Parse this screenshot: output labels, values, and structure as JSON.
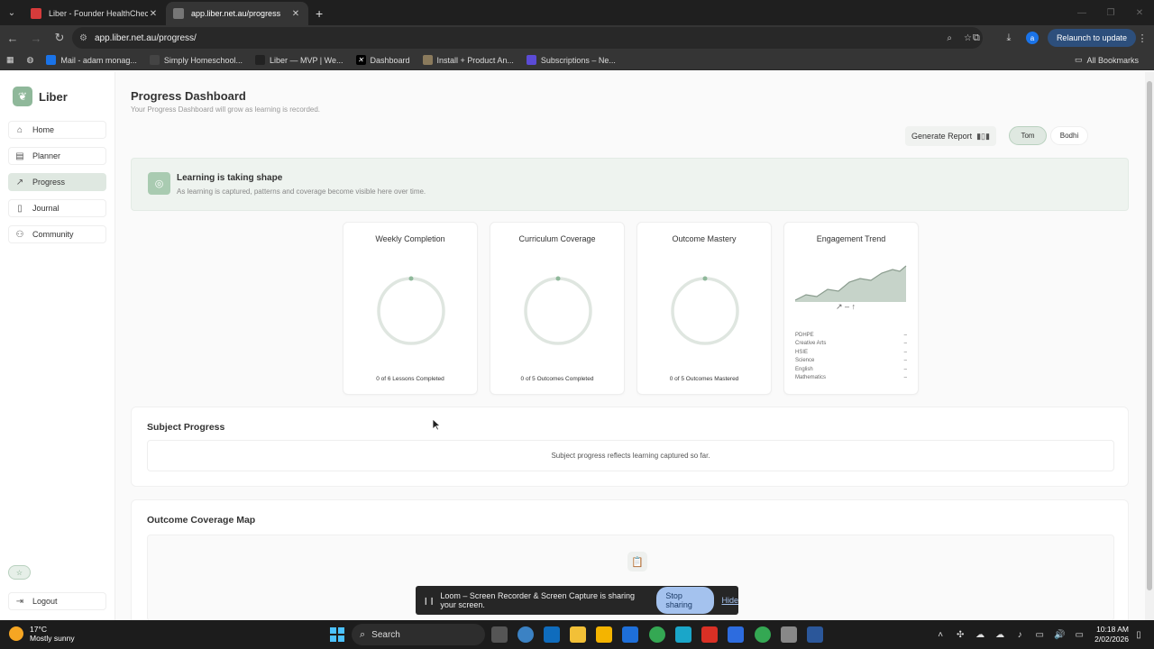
{
  "browser": {
    "tabs": [
      {
        "title": "Liber - Founder HealthCheck - Bulk Data"
      },
      {
        "title": "app.liber.net.au/progress"
      }
    ],
    "url": "app.liber.net.au/progress/",
    "relaunch_label": "Relaunch to update",
    "profile_initial": "a",
    "bookmarks": [
      {
        "label": "Mail - adam monag...",
        "color": "#1a73e8"
      },
      {
        "label": "Simply Homeschool...",
        "color": "#444444"
      },
      {
        "label": "Liber — MVP | We...",
        "color": "#222222"
      },
      {
        "label": "Dashboard",
        "color": "#000000"
      },
      {
        "label": "Install + Product An...",
        "color": "#8a7a5c"
      },
      {
        "label": "Subscriptions – Ne...",
        "color": "#5b4bd6"
      }
    ],
    "all_bookmarks": "All Bookmarks"
  },
  "sidebar": {
    "brand": "Liber",
    "items": [
      {
        "label": "Home",
        "icon": "home-icon"
      },
      {
        "label": "Planner",
        "icon": "calendar-icon"
      },
      {
        "label": "Progress",
        "icon": "trend-icon"
      },
      {
        "label": "Journal",
        "icon": "book-icon"
      },
      {
        "label": "Community",
        "icon": "people-icon"
      }
    ],
    "logout": "Logout"
  },
  "header": {
    "title": "Progress Dashboard",
    "subtitle": "Your Progress Dashboard will grow as learning is recorded.",
    "generate_report": "Generate Report",
    "children": [
      "Tom",
      "Bodhi"
    ],
    "selected_child": "Tom"
  },
  "banner": {
    "title": "Learning is taking shape",
    "subtitle": "As learning is captured, patterns and coverage become visible here over time."
  },
  "cards": [
    {
      "title": "Weekly Completion",
      "footer": "0 of 6 Lessons Completed",
      "progress": 0
    },
    {
      "title": "Curriculum Coverage",
      "footer": "0 of 5 Outcomes Completed",
      "progress": 0
    },
    {
      "title": "Outcome Mastery",
      "footer": "0 of 5 Outcomes Mastered",
      "progress": 0
    }
  ],
  "engagement": {
    "title": "Engagement Trend",
    "keys": "↗ – ↑",
    "subjects": [
      {
        "name": "PDHPE",
        "value": "–"
      },
      {
        "name": "Creative Arts",
        "value": "–"
      },
      {
        "name": "HSIE",
        "value": "–"
      },
      {
        "name": "Science",
        "value": "–"
      },
      {
        "name": "English",
        "value": "–"
      },
      {
        "name": "Mathematics",
        "value": "–"
      }
    ]
  },
  "subject_progress": {
    "title": "Subject Progress",
    "message": "Subject progress reflects learning captured so far."
  },
  "outcome_map": {
    "title": "Outcome Coverage Map"
  },
  "loom": {
    "message": "Loom – Screen Recorder & Screen Capture is sharing your screen.",
    "stop": "Stop sharing",
    "hide": "Hide"
  },
  "taskbar": {
    "temp": "17°C",
    "weather": "Mostly sunny",
    "search": "Search",
    "time": "10:18 AM",
    "date": "2/02/2026"
  },
  "colors": {
    "accent": "#8fb89a",
    "accent_light": "#dfe8e1",
    "ring": "#dfe6e0"
  }
}
